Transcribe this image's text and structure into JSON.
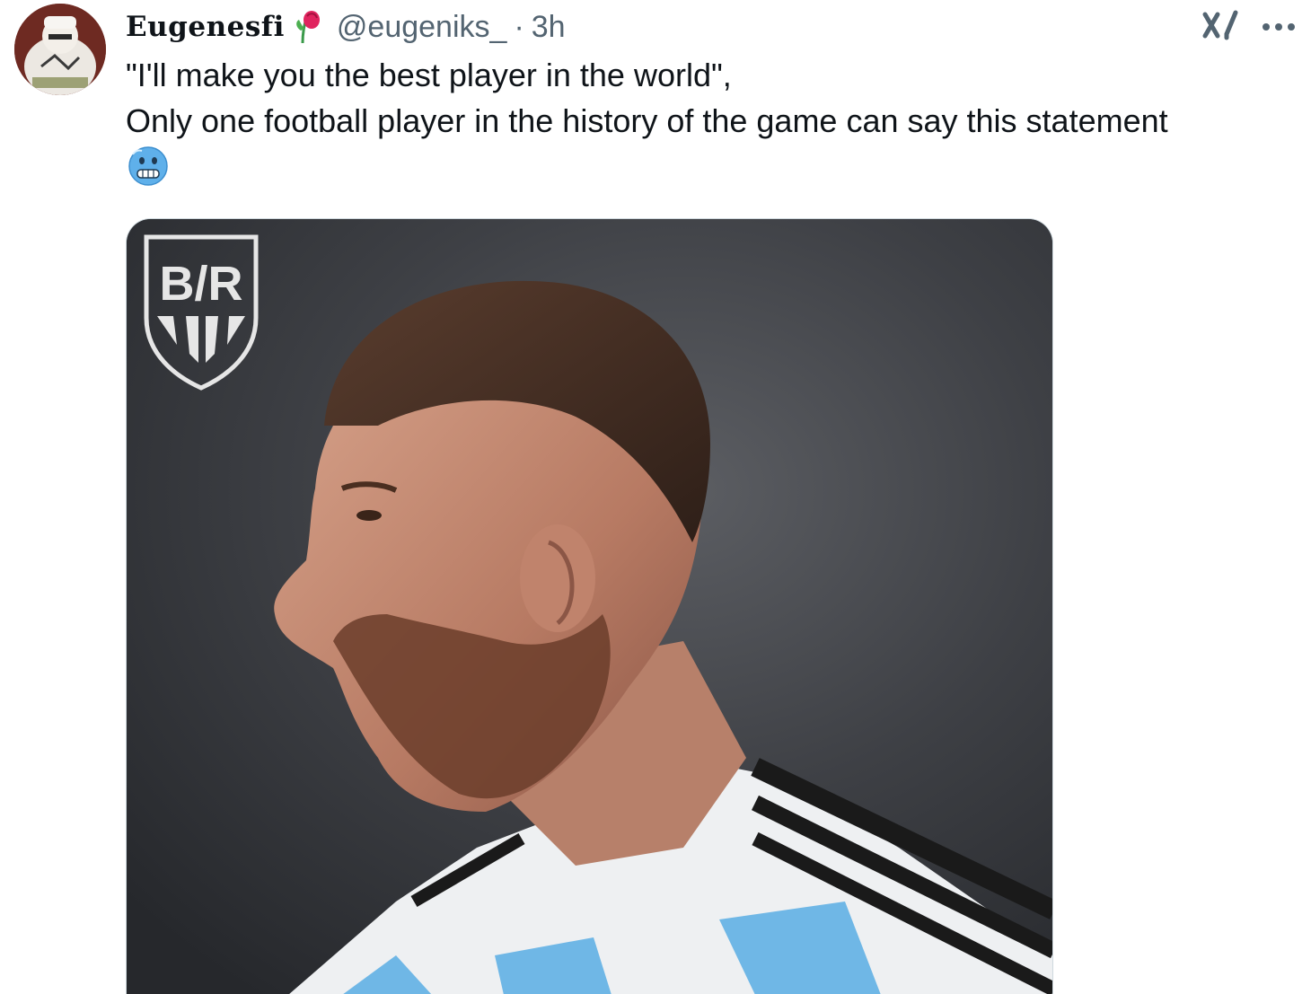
{
  "author": {
    "display_name": "Eugenesfi",
    "handle": "@eugeniks_",
    "separator": "·",
    "time_ago": "3h",
    "badge_icon": "rose-icon"
  },
  "tweet": {
    "line1": "\"I'll make you the best player in the world\",",
    "line2": "Only one football player in the history of the game can say this statement",
    "emoji": "cold-face-emoji"
  },
  "media": {
    "logo_text": "B/R",
    "kind": "photo"
  },
  "actions": {
    "grok_icon": "grok-icon",
    "more_icon": "more-options-icon"
  }
}
